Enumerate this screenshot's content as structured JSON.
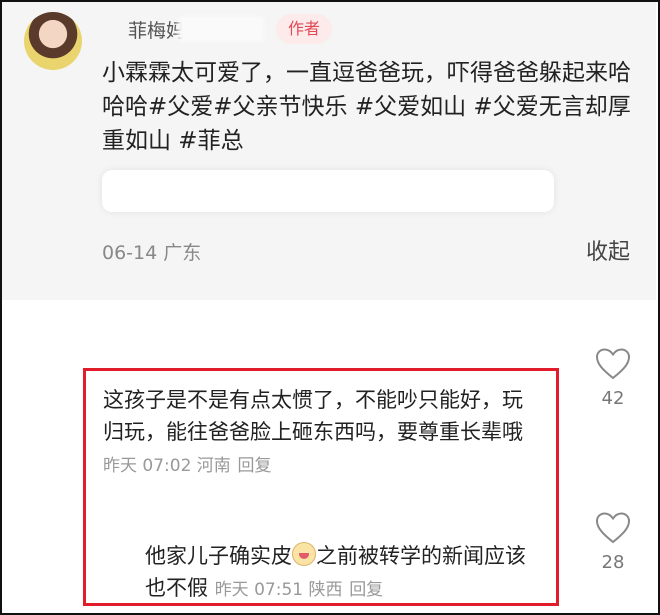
{
  "post": {
    "author_name": "菲梅妈",
    "author_tag": "作者",
    "text": "小霖霖太可爱了，一直逗爸爸玩，吓得爸爸躲起来哈哈哈#父爱#父亲节快乐 #父爱如山 #父爱无言却厚重如山 #菲总",
    "date_location": "06-14 广东",
    "collapse_label": "收起"
  },
  "comments": [
    {
      "text": "这孩子是不是有点太惯了，不能吵只能好，玩归玩，能往爸爸脸上砸东西吗，要尊重长辈哦",
      "time_location": "昨天 07:02 河南",
      "reply_label": "回复",
      "likes": "42"
    },
    {
      "text_before_emoji": "他家儿子确实皮",
      "emoji": "crying-face-emoji",
      "text_after_emoji": "之前被转学的新闻应该也不假",
      "time_location": "昨天 07:51 陕西",
      "reply_label": "回复",
      "likes": "28"
    }
  ],
  "colors": {
    "highlight_border": "#e11c2b",
    "author_tag_text": "#e24a55",
    "author_tag_bg": "#fdeaea"
  }
}
